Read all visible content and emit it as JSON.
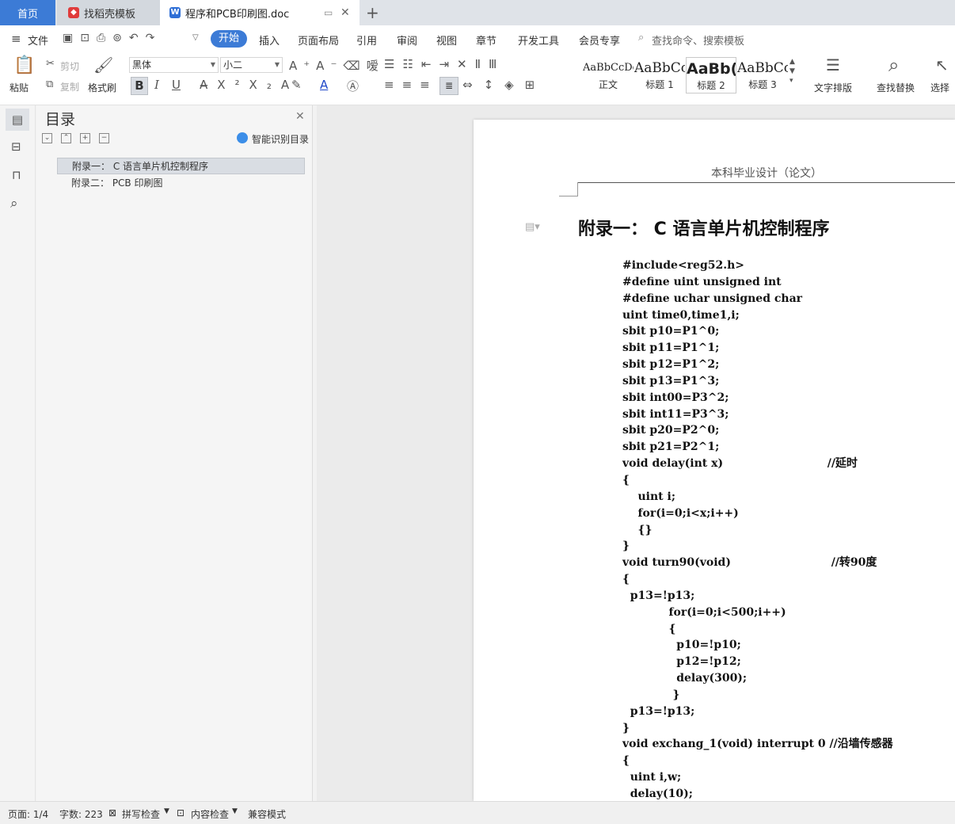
{
  "tabs": {
    "home": "首页",
    "template": "找稻壳模板",
    "doc": "程序和PCB印刷图.doc"
  },
  "menu": {
    "file": "文件",
    "items": [
      "开始",
      "插入",
      "页面布局",
      "引用",
      "审阅",
      "视图",
      "章节",
      "开发工具",
      "会员专享"
    ],
    "search_placeholder": "查找命令、搜索模板"
  },
  "ribbon": {
    "paste": "粘贴",
    "cut": "剪切",
    "copy": "复制",
    "format_painter": "格式刷",
    "font_name": "黑体",
    "font_size": "小二",
    "styles": [
      {
        "sample": "AaBbCcDd",
        "name": "正文"
      },
      {
        "sample": "AaBbCc",
        "name": "标题 1"
      },
      {
        "sample": "AaBb(",
        "name": "标题 2"
      },
      {
        "sample": "AaBbCcI",
        "name": "标题 3"
      }
    ],
    "text_layout": "文字排版",
    "find_replace": "查找替换",
    "select": "选择"
  },
  "nav": {
    "title": "目录",
    "smart_toc": "智能识别目录",
    "items": [
      "附录一：  C 语言单片机控制程序",
      "附录二：  PCB 印刷图"
    ]
  },
  "document": {
    "header": "本科毕业设计（论文）",
    "heading": "附录一：  C 语言单片机控制程序",
    "code": "#include<reg52.h>\n#define uint unsigned int\n#define uchar unsigned char\nuint time0,time1,i;\nsbit p10=P1^0;\nsbit p11=P1^1;\nsbit p12=P1^2;\nsbit p13=P1^3;\nsbit int00=P3^2;\nsbit int11=P3^3;\nsbit p20=P2^0;\nsbit p21=P2^1;\nvoid delay(int x)                           //延时\n{\n    uint i;\n    for(i=0;i<x;i++)\n    {}\n}\nvoid turn90(void)                          //转90度\n{\n  p13=!p13;\n            for(i=0;i<500;i++)\n            {\n              p10=!p10;\n              p12=!p12;\n              delay(300);\n             }\n  p13=!p13;\n}\nvoid exchang_1(void) interrupt 0 //沿墙传感器\n{\n  uint i,w;\n  delay(10);"
  },
  "status": {
    "page": "页面: 1/4",
    "words": "字数: 223",
    "spell": "拼写检查",
    "content": "内容检查",
    "compat": "兼容模式"
  },
  "colors": {
    "accent": "#3c7bd6"
  }
}
